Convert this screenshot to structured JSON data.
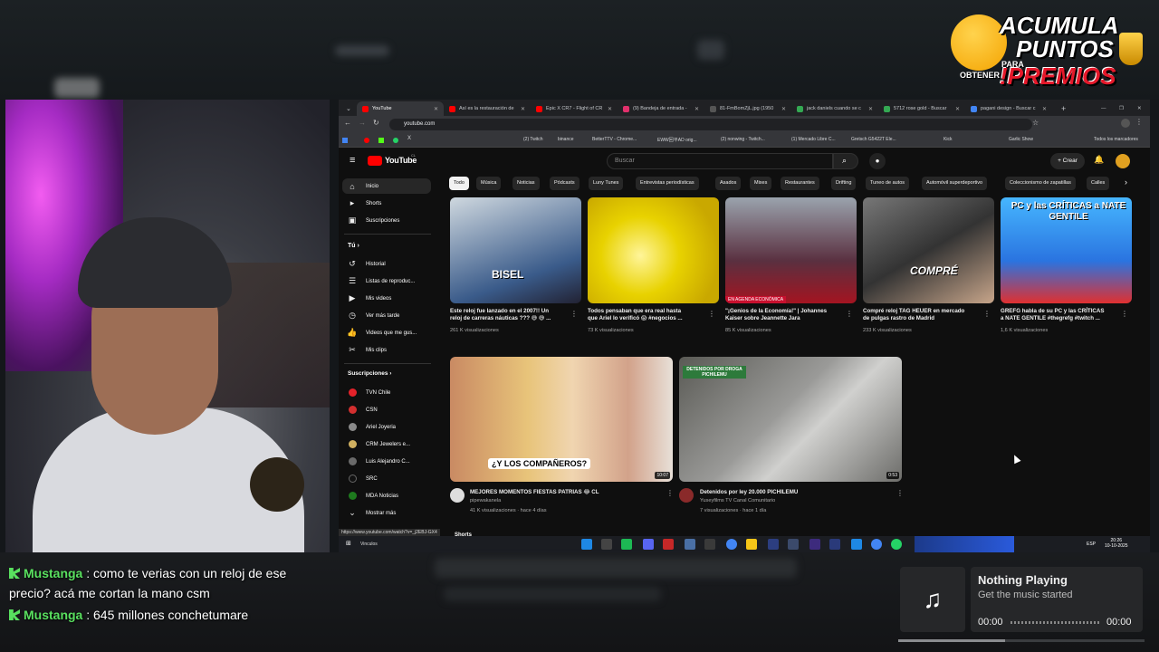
{
  "browser": {
    "tabs": [
      {
        "label": "YouTube",
        "color": "#ff0000",
        "active": true
      },
      {
        "label": "Así es la restauración de",
        "color": "#ff0000",
        "active": false
      },
      {
        "label": "Epic X CR7 - Flight of CR",
        "color": "#ff0000",
        "active": false
      },
      {
        "label": "(9) Bandeja de entrada -",
        "color": "#e1306c",
        "active": false
      },
      {
        "label": "81-FmBomZjL.jpg (1950",
        "color": "#555555",
        "active": false
      },
      {
        "label": "jack daniels cuando se c",
        "color": "#34a853",
        "active": false
      },
      {
        "label": "5712 rose gold - Buscar",
        "color": "#34a853",
        "active": false
      },
      {
        "label": "pagani design - Buscar c",
        "color": "#4285f4",
        "active": false
      }
    ],
    "url": "youtube.com",
    "bookmarks": [
      "(2) Twitch",
      "binance",
      "BetterTTV - Chrome...",
      "EWW回平AD orig...",
      "(2) nonwing - Twitch...",
      "(1) Mercado Libre C...",
      "Gretsch G5422T Ele...",
      "Kick",
      "Garlic Show",
      "Todos los marcadores"
    ],
    "status_url": "https://www.youtube.com/watch?v=_j2EBJ-GX4"
  },
  "youtube": {
    "logo": "YouTube",
    "logo_region": "CL",
    "search_placeholder": "Buscar",
    "create_label": "Crear",
    "chips": [
      "Todo",
      "Música",
      "Noticias",
      "Pódcasts",
      "Luny Tunes",
      "Entrevistas periodísticas",
      "Asados",
      "Mixes",
      "Restaurantes",
      "Drifting",
      "Tuneo de autos",
      "Automóvil superdeportivo",
      "Coleccionismo de zapatillas",
      "Calles"
    ],
    "sidebar": {
      "main": [
        {
          "label": "Inicio",
          "icon": "home-icon"
        },
        {
          "label": "Shorts",
          "icon": "shorts-icon"
        },
        {
          "label": "Suscripciones",
          "icon": "subscriptions-icon"
        }
      ],
      "you_header": "Tú",
      "you": [
        {
          "label": "Historial",
          "icon": "history-icon"
        },
        {
          "label": "Listas de reproduc...",
          "icon": "playlist-icon"
        },
        {
          "label": "Mis videos",
          "icon": "my-videos-icon"
        },
        {
          "label": "Ver más tarde",
          "icon": "watch-later-icon"
        },
        {
          "label": "Videos que me gus...",
          "icon": "thumbs-up-icon"
        },
        {
          "label": "Mis clips",
          "icon": "clips-icon"
        }
      ],
      "subs_header": "Suscripciones",
      "subs": [
        {
          "label": "TVN Chile",
          "color": "#e4222a"
        },
        {
          "label": "CSN",
          "color": "#d32f2f"
        },
        {
          "label": "Ariel Joyeria",
          "color": "#8a8a8a"
        },
        {
          "label": "CRM Jewelers e...",
          "color": "#d0b060"
        },
        {
          "label": "Luis Alejandro C...",
          "color": "#6a6a6a"
        },
        {
          "label": "SRC",
          "color": "#222222"
        },
        {
          "label": "MDA Noticias",
          "color": "#1e7a1e"
        }
      ],
      "show_more": "Mostrar más"
    },
    "row1": [
      {
        "title_line1": "Este reloj fue lanzado en el 2007!! Un",
        "title_line2": "reloj de carreras náuticas ??? 😅 😅 ...",
        "views": "261 K visualizaciones",
        "overlay": "BISEL"
      },
      {
        "title_line1": "Todos pensaban que era real hasta",
        "title_line2": "que Ariel lo verificó 😱 #negocios ...",
        "views": "73 K visualizaciones",
        "overlay": ""
      },
      {
        "title_line1": "\"¡Genios de la Economía!\" | Johannes",
        "title_line2": "Kaiser sobre Jeannette Jara",
        "views": "85 K visualizaciones",
        "overlay": "EN AGENDA ECONÓMICA"
      },
      {
        "title_line1": "Compré reloj TAG HEUER en mercado",
        "title_line2": "de pulgas rastro de Madrid",
        "views": "233 K visualizaciones",
        "overlay": "COMPRÉ"
      },
      {
        "title_line1": "GREFG habla de su PC y las CRÍTICAS",
        "title_line2": "a NATE GENTILE #thegrefg #twitch ...",
        "views": "1,6 K visualizaciones",
        "overlay": "PC y las CRÍTICAS a NATE GENTILE"
      }
    ],
    "row2": [
      {
        "title": "MEJORES MOMENTOS FIESTAS PATRIAS 😂 CL",
        "channel": "pipewakanela",
        "meta": "41 K visualizaciones · hace 4 días",
        "duration": "10:07",
        "overlay": "¿Y LOS COMPAÑEROS?"
      },
      {
        "title": "Detenidos por ley 20.000 PICHILEMU",
        "channel": "Yuseyfilms TV Canal Comunitario",
        "meta": "7 visualizaciones · hace 1 día",
        "duration": "0:53",
        "overlay": "DETENIDOS POR DROGA PICHILEMU"
      }
    ],
    "shorts_label": "Shorts"
  },
  "taskbar": {
    "left_label": "Vinculos",
    "lang": "ESP",
    "time": "20:26",
    "date": "10-10-2025"
  },
  "promo": {
    "line1": "ACUMULA",
    "line2": "PUNTOS",
    "line3": "!PREMIOS",
    "small1": "PARA",
    "small2": "OBTENER"
  },
  "chat": [
    {
      "user": "Mustanga",
      "text": ": como te verias con un reloj de ese"
    },
    {
      "user": "",
      "text": "precio? acá me cortan la mano csm"
    },
    {
      "user": "Mustanga",
      "text": ": 645 millones conchetumare"
    }
  ],
  "music": {
    "title": "Nothing Playing",
    "subtitle": "Get the music started",
    "time_start": "00:00",
    "time_end": "00:00"
  }
}
